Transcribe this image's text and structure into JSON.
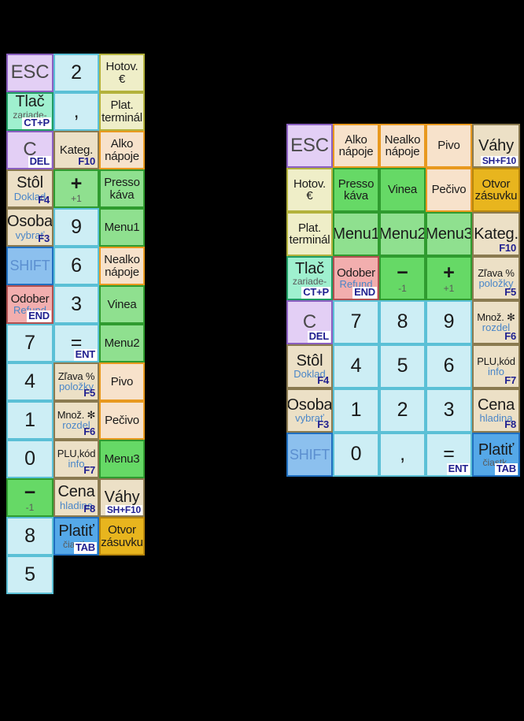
{
  "meta": {
    "background": "#000000",
    "description": "POS cash-register keyboard layout reference, two key grids"
  },
  "palette": {
    "cyan": "#cdeef5",
    "cyan_border": "#5bc0d6",
    "lilac": "#e3cff5",
    "lilac_border": "#8a5fc0",
    "mint": "#9ff0cf",
    "mint_border": "#1f9b63",
    "beige": "#ece0c6",
    "beige_border": "#8a7a50",
    "cream": "#efeec8",
    "cream_border": "#b3b23c",
    "peach": "#f7e2cb",
    "peach_border": "#e8991f",
    "green": "#8fe08f",
    "green_border": "#2f9b2f",
    "green_bright": "#66d966",
    "green_bright_border": "#2f9b2f",
    "pink": "#f2aeae",
    "pink_border": "#b05050",
    "blue": "#8cc0ee",
    "blue_border": "#1f6fc0",
    "blue_strong": "#55a8e8",
    "blue_strong_border": "#1f6fc0",
    "gold": "#e8b51e",
    "gold_border": "#b8860b",
    "badge_text": "#1f1f8f",
    "sub_text": "#4a86c8"
  },
  "left_keypad": {
    "name": "compact-3-column-keypad",
    "columns": 3,
    "rows": 17,
    "keys": [
      {
        "main": "ESC",
        "size": "esc",
        "bg": "lilac",
        "border": "lilac_border"
      },
      {
        "main": "2",
        "size": "digit",
        "bg": "cyan",
        "border": "cyan_border"
      },
      {
        "main": "Hotov.\n€",
        "size": "med",
        "bg": "cream",
        "border": "cream_border"
      },
      {
        "main": "Tlač",
        "size": "big",
        "note": "zariade-\nnie",
        "badge": "CT+P",
        "bg": "mint",
        "border": "mint_border"
      },
      {
        "main": ",",
        "size": "digit",
        "bg": "cyan",
        "border": "cyan_border"
      },
      {
        "main": "Plat.\nterminál",
        "size": "med",
        "bg": "cream",
        "border": "cream_border"
      },
      {
        "main": "C",
        "size": "esc",
        "badge": "DEL",
        "bg": "lilac",
        "border": "lilac_border"
      },
      {
        "main": "Kateg.",
        "size": "med",
        "badge": "F10",
        "badge_plain": true,
        "bg": "beige",
        "border": "beige_border"
      },
      {
        "main": "Alko\nnápoje",
        "size": "med",
        "bg": "peach",
        "border": "peach_border"
      },
      {
        "main": "Stôl",
        "size": "big",
        "sub": "Doklad",
        "badge": "F4",
        "badge_plain": true,
        "bg": "beige",
        "border": "beige_border"
      },
      {
        "main": "+",
        "size": "plusmin",
        "note": "+1",
        "bg": "green",
        "border": "green_border"
      },
      {
        "main": "Presso\nkáva",
        "size": "med",
        "bg": "green",
        "border": "green_border"
      },
      {
        "main": "Osoba",
        "size": "big",
        "sub": "vybrať",
        "badge": "F3",
        "badge_plain": true,
        "bg": "beige",
        "border": "beige_border"
      },
      {
        "main": "9",
        "size": "digit",
        "bg": "cyan",
        "border": "cyan_border"
      },
      {
        "main": "Menu1",
        "size": "med",
        "bg": "green",
        "border": "green_border"
      },
      {
        "main": "SHIFT",
        "size": "shift",
        "bg": "blue",
        "border": "blue_border"
      },
      {
        "main": "6",
        "size": "digit",
        "bg": "cyan",
        "border": "cyan_border"
      },
      {
        "main": "Nealko\nnápoje",
        "size": "med",
        "bg": "peach",
        "border": "peach_border"
      },
      {
        "main": "Odober",
        "size": "med",
        "sub": "Refund",
        "badge": "END",
        "bg": "pink",
        "border": "pink_border"
      },
      {
        "main": "3",
        "size": "digit",
        "bg": "cyan",
        "border": "cyan_border"
      },
      {
        "main": "Vinea",
        "size": "med",
        "bg": "green",
        "border": "green_border"
      },
      {
        "main": "7",
        "size": "digit",
        "bg": "cyan",
        "border": "cyan_border"
      },
      {
        "main": "=",
        "size": "digit",
        "badge": "ENT",
        "bg": "cyan",
        "border": "cyan_border"
      },
      {
        "main": "Menu2",
        "size": "med",
        "bg": "green",
        "border": "green_border"
      },
      {
        "main": "4",
        "size": "digit",
        "bg": "cyan",
        "border": "cyan_border"
      },
      {
        "main": "Zľava %",
        "size": "small",
        "sub": "položky",
        "badge": "F5",
        "badge_plain": true,
        "bg": "beige",
        "border": "beige_border"
      },
      {
        "main": "Pivo",
        "size": "med",
        "bg": "peach",
        "border": "peach_border"
      },
      {
        "main": "1",
        "size": "digit",
        "bg": "cyan",
        "border": "cyan_border"
      },
      {
        "main": "Množ. ✻",
        "size": "small",
        "sub": "rozdel",
        "badge": "F6",
        "badge_plain": true,
        "bg": "beige",
        "border": "beige_border"
      },
      {
        "main": "Pečivo",
        "size": "med",
        "bg": "peach",
        "border": "peach_border"
      },
      {
        "main": "0",
        "size": "digit",
        "bg": "cyan",
        "border": "cyan_border"
      },
      {
        "main": "PLU,kód",
        "size": "small",
        "sub": "info",
        "badge": "F7",
        "badge_plain": true,
        "bg": "beige",
        "border": "beige_border"
      },
      {
        "main": "Menu3",
        "size": "med",
        "bg": "green_bright",
        "border": "green_bright_border"
      },
      {
        "main": "−",
        "size": "plusmin",
        "note": "-1",
        "bg": "green_bright",
        "border": "green_bright_border"
      },
      {
        "main": "Cena",
        "size": "big",
        "sub": "hladina",
        "badge": "F8",
        "badge_plain": true,
        "bg": "beige",
        "border": "beige_border"
      },
      {
        "main": "Váhy",
        "size": "big",
        "badge": "SH+F10",
        "badge_wide": true,
        "bg": "beige",
        "border": "beige_border"
      },
      {
        "main": "8",
        "size": "digit",
        "bg": "cyan",
        "border": "cyan_border"
      },
      {
        "main": "Platiť",
        "size": "big",
        "note": "čiastk.",
        "badge": "TAB",
        "bg": "blue_strong",
        "border": "blue_strong_border"
      },
      {
        "main": "Otvor\nzásuvku",
        "size": "med",
        "bg": "gold",
        "border": "gold_border"
      },
      {
        "main": "5",
        "size": "digit",
        "bg": "cyan",
        "border": "cyan_border"
      },
      {
        "empty": true
      },
      {
        "empty": true
      }
    ]
  },
  "right_keypad": {
    "name": "wide-5-column-keypad",
    "columns": 5,
    "rows": 8,
    "keys": [
      {
        "main": "ESC",
        "size": "esc",
        "bg": "lilac",
        "border": "lilac_border"
      },
      {
        "main": "Alko\nnápoje",
        "size": "med",
        "bg": "peach",
        "border": "peach_border"
      },
      {
        "main": "Nealko\nnápoje",
        "size": "med",
        "bg": "peach",
        "border": "peach_border"
      },
      {
        "main": "Pivo",
        "size": "med",
        "bg": "peach",
        "border": "peach_border"
      },
      {
        "main": "Váhy",
        "size": "big",
        "badge": "SH+F10",
        "badge_wide": true,
        "bg": "beige",
        "border": "beige_border"
      },
      {
        "main": "Hotov.\n€",
        "size": "med",
        "bg": "cream",
        "border": "cream_border"
      },
      {
        "main": "Presso\nkáva",
        "size": "med",
        "bg": "green_bright",
        "border": "green_border"
      },
      {
        "main": "Vinea",
        "size": "med",
        "bg": "green_bright",
        "border": "green_border"
      },
      {
        "main": "Pečivo",
        "size": "med",
        "bg": "peach",
        "border": "peach_border"
      },
      {
        "main": "Otvor\nzásuvku",
        "size": "med",
        "bg": "gold",
        "border": "gold_border"
      },
      {
        "main": "Plat.\nterminál",
        "size": "med",
        "bg": "cream",
        "border": "cream_border"
      },
      {
        "main": "Menu1",
        "size": "big",
        "bg": "green",
        "border": "green_border"
      },
      {
        "main": "Menu2",
        "size": "big",
        "bg": "green",
        "border": "green_border"
      },
      {
        "main": "Menu3",
        "size": "big",
        "bg": "green",
        "border": "green_border"
      },
      {
        "main": "Kateg.",
        "size": "big",
        "badge": "F10",
        "badge_plain": true,
        "bg": "beige",
        "border": "beige_border"
      },
      {
        "main": "Tlač",
        "size": "big",
        "note": "zariade-\nnie",
        "badge": "CT+P",
        "bg": "mint",
        "border": "mint_border"
      },
      {
        "main": "Odober",
        "size": "med",
        "sub": "Refund",
        "badge": "END",
        "bg": "pink",
        "border": "pink_border"
      },
      {
        "main": "−",
        "size": "plusmin",
        "note": "-1",
        "bg": "green_bright",
        "border": "green_bright_border"
      },
      {
        "main": "+",
        "size": "plusmin",
        "note": "+1",
        "bg": "green_bright",
        "border": "green_bright_border"
      },
      {
        "main": "Zľava %",
        "size": "small",
        "sub": "položky",
        "badge": "F5",
        "badge_plain": true,
        "bg": "beige",
        "border": "beige_border"
      },
      {
        "main": "C",
        "size": "esc",
        "badge": "DEL",
        "bg": "lilac",
        "border": "lilac_border"
      },
      {
        "main": "7",
        "size": "digit",
        "bg": "cyan",
        "border": "cyan_border"
      },
      {
        "main": "8",
        "size": "digit",
        "bg": "cyan",
        "border": "cyan_border"
      },
      {
        "main": "9",
        "size": "digit",
        "bg": "cyan",
        "border": "cyan_border"
      },
      {
        "main": "Množ. ✻",
        "size": "small",
        "sub": "rozdel",
        "badge": "F6",
        "badge_plain": true,
        "bg": "beige",
        "border": "beige_border"
      },
      {
        "main": "Stôl",
        "size": "big",
        "sub": "Doklad",
        "badge": "F4",
        "badge_plain": true,
        "bg": "beige",
        "border": "beige_border"
      },
      {
        "main": "4",
        "size": "digit",
        "bg": "cyan",
        "border": "cyan_border"
      },
      {
        "main": "5",
        "size": "digit",
        "bg": "cyan",
        "border": "cyan_border"
      },
      {
        "main": "6",
        "size": "digit",
        "bg": "cyan",
        "border": "cyan_border"
      },
      {
        "main": "PLU,kód",
        "size": "small",
        "sub": "info",
        "badge": "F7",
        "badge_plain": true,
        "bg": "beige",
        "border": "beige_border"
      },
      {
        "main": "Osoba",
        "size": "big",
        "sub": "vybrať",
        "badge": "F3",
        "badge_plain": true,
        "bg": "beige",
        "border": "beige_border"
      },
      {
        "main": "1",
        "size": "digit",
        "bg": "cyan",
        "border": "cyan_border"
      },
      {
        "main": "2",
        "size": "digit",
        "bg": "cyan",
        "border": "cyan_border"
      },
      {
        "main": "3",
        "size": "digit",
        "bg": "cyan",
        "border": "cyan_border"
      },
      {
        "main": "Cena",
        "size": "big",
        "sub": "hladina",
        "badge": "F8",
        "badge_plain": true,
        "bg": "beige",
        "border": "beige_border"
      },
      {
        "main": "SHIFT",
        "size": "shift",
        "bg": "blue",
        "border": "blue_border"
      },
      {
        "main": "0",
        "size": "digit",
        "bg": "cyan",
        "border": "cyan_border"
      },
      {
        "main": ",",
        "size": "digit",
        "bg": "cyan",
        "border": "cyan_border"
      },
      {
        "main": "=",
        "size": "digit",
        "badge": "ENT",
        "bg": "cyan",
        "border": "cyan_border"
      },
      {
        "main": "Platiť",
        "size": "big",
        "note": "čiastk.",
        "badge": "TAB",
        "bg": "blue_strong",
        "border": "blue_strong_border"
      }
    ]
  }
}
